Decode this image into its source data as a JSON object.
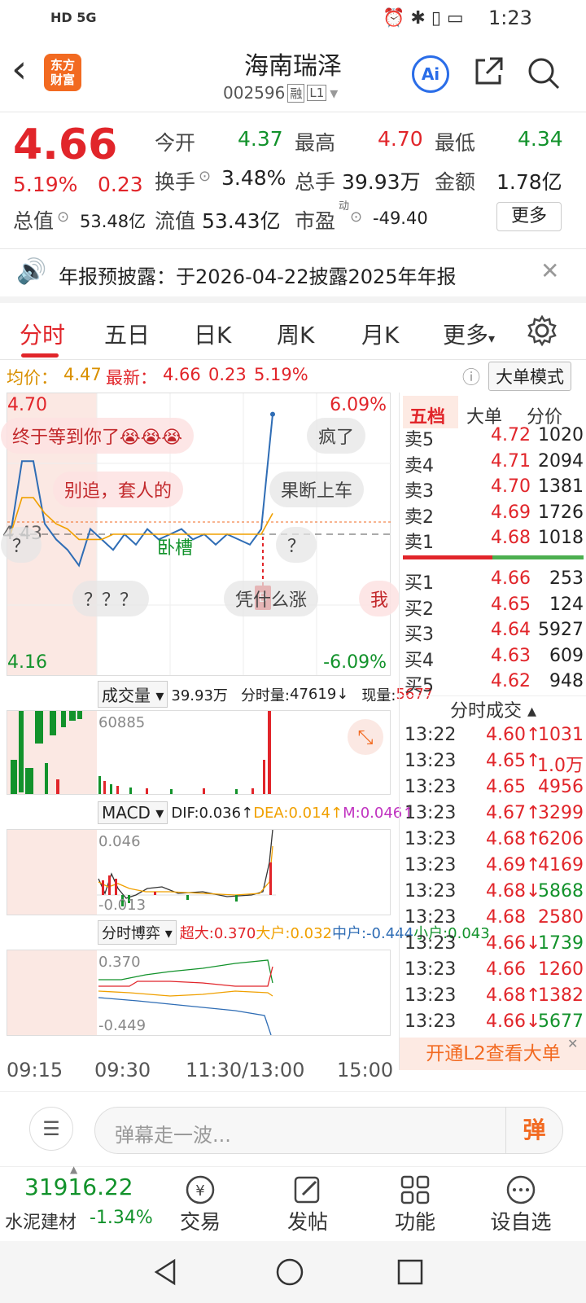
{
  "status_bar": {
    "left_text": "HD 5G",
    "time": "1:23"
  },
  "header": {
    "back_label": "‹",
    "logo_text": "东方\n财富",
    "stock_name": "海南瑞泽",
    "stock_code": "002596",
    "tag_rong": "融",
    "tag_l1": "L1",
    "ai_label": "Ai"
  },
  "quote": {
    "price": "4.66",
    "change_pct": "5.19%",
    "change": "0.23",
    "open_label": "今开",
    "open": "4.37",
    "high_label": "最高",
    "high": "4.70",
    "low_label": "最低",
    "low": "4.34",
    "turnover_label": "换手",
    "turnover": "3.48%",
    "volume_label": "总手",
    "volume": "39.93万",
    "amount_label": "金额",
    "amount": "1.78亿",
    "mktcap_label": "总值",
    "mktcap": "53.48亿",
    "float_label": "流值",
    "float": "53.43亿",
    "pe_label": "市盈",
    "pe_sup": "动",
    "pe": "-49.40",
    "more_label": "更多"
  },
  "announcement": {
    "text": "年报预披露：于2026-04-22披露2025年年报"
  },
  "tabs": [
    "分时",
    "五日",
    "日K",
    "周K",
    "月K",
    "更多"
  ],
  "avg_line": {
    "avg_label": "均价：",
    "avg": "4.47",
    "latest_label": "最新：",
    "latest": "4.66",
    "change": "0.23",
    "pct": "5.19%",
    "mode_btn": "大单模式"
  },
  "chart": {
    "price_top": "4.70",
    "price_mid": "4.43",
    "price_bottom": "4.16",
    "pct_top": "6.09%",
    "pct_bottom": "-6.09%",
    "mid_label": "卧槽",
    "marker": "B",
    "volume_header": {
      "dropdown": "成交量",
      "total": "39.93万",
      "tick_label": "分时量:",
      "tick_val": "47619",
      "now_label": "现量:",
      "now_val": "5677",
      "max": "60885"
    },
    "macd_header": {
      "dropdown": "MACD",
      "dif": "DIF:0.036",
      "dea": "DEA:0.014",
      "m": "M:0.046",
      "top": "0.046",
      "bottom": "-0.013"
    },
    "flow_header": {
      "dropdown": "分时博弈",
      "super": "超大:0.370",
      "big": "大户:0.032",
      "mid": "中户:-0.444",
      "small": "小户:0.043",
      "top": "0.370",
      "bottom": "-0.449"
    },
    "time_axis": [
      "09:15",
      "09:30",
      "11:30/13:00",
      "15:00"
    ]
  },
  "chart_data": {
    "type": "line",
    "title": "",
    "ylim": [
      4.16,
      4.7
    ],
    "reference": 4.43,
    "series": [
      {
        "name": "价格",
        "values": [
          4.43,
          4.57,
          4.57,
          4.45,
          4.42,
          4.4,
          4.37,
          4.44,
          4.42,
          4.4,
          4.43,
          4.41,
          4.44,
          4.42,
          4.43,
          4.44,
          4.42,
          4.43,
          4.41,
          4.43,
          4.42,
          4.41,
          4.44,
          4.66
        ]
      },
      {
        "name": "均价",
        "values": [
          4.43,
          4.5,
          4.5,
          4.47,
          4.45,
          4.44,
          4.42,
          4.42,
          4.42,
          4.43,
          4.43,
          4.43,
          4.43,
          4.43,
          4.43,
          4.43,
          4.43,
          4.43,
          4.43,
          4.43,
          4.43,
          4.43,
          4.43,
          4.47
        ]
      }
    ]
  },
  "danmaku": [
    {
      "text": "终于等到你了😭😭😭",
      "style": "pink"
    },
    {
      "text": "疯了",
      "style": "gray"
    },
    {
      "text": "别追，套人的",
      "style": "pink"
    },
    {
      "text": "果断上车",
      "style": "gray"
    },
    {
      "text": "？",
      "style": "gray"
    },
    {
      "text": "？",
      "style": "gray"
    },
    {
      "text": "？？？",
      "style": "gray"
    },
    {
      "text": "凭什么涨",
      "style": "gray"
    },
    {
      "text": "我",
      "style": "pink"
    }
  ],
  "order_book": {
    "tabs": [
      "五档",
      "大单",
      "分价"
    ],
    "asks": [
      {
        "label": "卖5",
        "price": "4.72",
        "vol": "1020"
      },
      {
        "label": "卖4",
        "price": "4.71",
        "vol": "2094"
      },
      {
        "label": "卖3",
        "price": "4.70",
        "vol": "1381"
      },
      {
        "label": "卖2",
        "price": "4.69",
        "vol": "1726"
      },
      {
        "label": "卖1",
        "price": "4.68",
        "vol": "1018"
      }
    ],
    "bids": [
      {
        "label": "买1",
        "price": "4.66",
        "vol": "253"
      },
      {
        "label": "买2",
        "price": "4.65",
        "vol": "124"
      },
      {
        "label": "买3",
        "price": "4.64",
        "vol": "5927"
      },
      {
        "label": "买4",
        "price": "4.63",
        "vol": "609"
      },
      {
        "label": "买5",
        "price": "4.62",
        "vol": "948"
      }
    ],
    "ticks_header": "分时成交",
    "ticks": [
      {
        "time": "13:22",
        "price": "4.60",
        "arrow": "↑",
        "vol": "1031",
        "color": "red"
      },
      {
        "time": "13:23",
        "price": "4.65",
        "arrow": "↑",
        "vol": "1.0万",
        "color": "red"
      },
      {
        "time": "13:23",
        "price": "4.65",
        "arrow": "",
        "vol": "4956",
        "color": "red"
      },
      {
        "time": "13:23",
        "price": "4.67",
        "arrow": "↑",
        "vol": "3299",
        "color": "red"
      },
      {
        "time": "13:23",
        "price": "4.68",
        "arrow": "↑",
        "vol": "6206",
        "color": "red"
      },
      {
        "time": "13:23",
        "price": "4.69",
        "arrow": "↑",
        "vol": "4169",
        "color": "red"
      },
      {
        "time": "13:23",
        "price": "4.68",
        "arrow": "↓",
        "vol": "5868",
        "color": "green"
      },
      {
        "time": "13:23",
        "price": "4.68",
        "arrow": "",
        "vol": "2580",
        "color": "red"
      },
      {
        "time": "13:23",
        "price": "4.66",
        "arrow": "↓",
        "vol": "1739",
        "color": "green"
      },
      {
        "time": "13:23",
        "price": "4.66",
        "arrow": "",
        "vol": "1260",
        "color": "red"
      },
      {
        "time": "13:23",
        "price": "4.68",
        "arrow": "↑",
        "vol": "1382",
        "color": "red"
      },
      {
        "time": "13:23",
        "price": "4.66",
        "arrow": "↓",
        "vol": "5677",
        "color": "green"
      }
    ],
    "l2_banner": "开通L2查看大单"
  },
  "comment": {
    "placeholder": "弹幕走一波...",
    "send_label": "弹"
  },
  "toolbar": {
    "index_value": "31916.22",
    "index_name": "水泥建材",
    "index_change": "-1.34%",
    "trade": "交易",
    "post": "发帖",
    "func": "功能",
    "watch": "设自选"
  },
  "colors": {
    "up": "#e1252a",
    "down": "#12922b",
    "price_line": "#2f6db5",
    "avg_line": "#f0a000",
    "accent": "#f26a21"
  }
}
